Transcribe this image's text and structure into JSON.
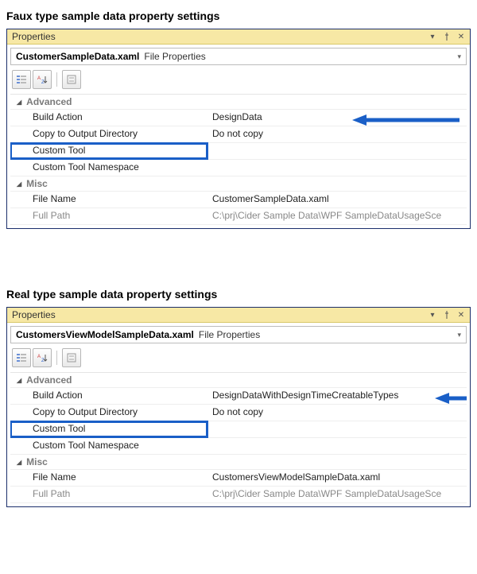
{
  "sections": [
    {
      "title": "Faux type sample data property settings",
      "panelTitle": "Properties",
      "objectName": "CustomerSampleData.xaml",
      "objectSubtitle": "File Properties",
      "categories": {
        "advanced": {
          "label": "Advanced",
          "buildActionLabel": "Build Action",
          "buildActionValue": "DesignData",
          "copyLabel": "Copy to Output Directory",
          "copyValue": "Do not copy",
          "customToolLabel": "Custom Tool",
          "customToolValue": "",
          "customToolNsLabel": "Custom Tool Namespace",
          "customToolNsValue": ""
        },
        "misc": {
          "label": "Misc",
          "fileNameLabel": "File Name",
          "fileNameValue": "CustomerSampleData.xaml",
          "fullPathLabel": "Full Path",
          "fullPathValue": "C:\\prj\\Cider Sample Data\\WPF SampleDataUsageSce"
        }
      }
    },
    {
      "title": "Real type sample data property settings",
      "panelTitle": "Properties",
      "objectName": "CustomersViewModelSampleData.xaml",
      "objectSubtitle": "File Properties",
      "categories": {
        "advanced": {
          "label": "Advanced",
          "buildActionLabel": "Build Action",
          "buildActionValue": "DesignDataWithDesignTimeCreatableTypes",
          "copyLabel": "Copy to Output Directory",
          "copyValue": "Do not copy",
          "customToolLabel": "Custom Tool",
          "customToolValue": "",
          "customToolNsLabel": "Custom Tool Namespace",
          "customToolNsValue": ""
        },
        "misc": {
          "label": "Misc",
          "fileNameLabel": "File Name",
          "fileNameValue": "CustomersViewModelSampleData.xaml",
          "fullPathLabel": "Full Path",
          "fullPathValue": "C:\\prj\\Cider Sample Data\\WPF SampleDataUsageSce"
        }
      }
    }
  ]
}
